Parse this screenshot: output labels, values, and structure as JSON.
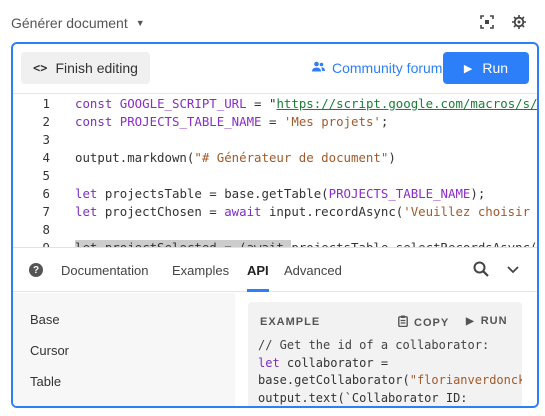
{
  "header": {
    "block_title": "Générer document",
    "icons": [
      "focus-icon",
      "settings-icon"
    ]
  },
  "toolbar": {
    "finish_label": "Finish editing",
    "forum_label": "Community forum",
    "run_label": "Run"
  },
  "editor": {
    "lines": [
      {
        "num": "1",
        "parts": [
          [
            "kw",
            "const "
          ],
          [
            "cn",
            "GOOGLE_SCRIPT_URL"
          ],
          [
            "id",
            " = \""
          ],
          [
            "url",
            "https://script.google.com/macros/s/AK"
          ]
        ]
      },
      {
        "num": "2",
        "parts": [
          [
            "kw",
            "const "
          ],
          [
            "cn",
            "PROJECTS_TABLE_NAME"
          ],
          [
            "id",
            " = "
          ],
          [
            "str",
            "'Mes projets'"
          ],
          [
            "id",
            ";"
          ]
        ]
      },
      {
        "num": "3",
        "parts": []
      },
      {
        "num": "4",
        "parts": [
          [
            "id",
            "output.markdown("
          ],
          [
            "str",
            "\"# Générateur de document\""
          ],
          [
            "id",
            ")"
          ]
        ]
      },
      {
        "num": "5",
        "parts": []
      },
      {
        "num": "6",
        "parts": [
          [
            "kw",
            "let "
          ],
          [
            "id",
            "projectsTable = base.getTable("
          ],
          [
            "cn",
            "PROJECTS_TABLE_NAME"
          ],
          [
            "id",
            ");"
          ]
        ]
      },
      {
        "num": "7",
        "parts": [
          [
            "kw",
            "let "
          ],
          [
            "id",
            "projectChosen = "
          ],
          [
            "kw",
            "await "
          ],
          [
            "id",
            "input.recordAsync("
          ],
          [
            "str",
            "'Veuillez choisir un"
          ]
        ]
      },
      {
        "num": "8",
        "parts": []
      },
      {
        "num": "9",
        "parts": [
          [
            "hl",
            "let projectSelected = (await "
          ],
          [
            "id",
            "projectsTable.selectRecordsAsync())"
          ]
        ]
      }
    ]
  },
  "docs": {
    "tabs": [
      "Documentation",
      "Examples",
      "API",
      "Advanced"
    ],
    "active_tab": "API",
    "sidebar": [
      "Base",
      "Cursor",
      "Table"
    ],
    "example": {
      "label": "EXAMPLE",
      "copy_label": "COPY",
      "run_label": "RUN",
      "code": [
        [
          [
            "cm",
            "// Get the id of a collaborator:"
          ]
        ],
        [
          [
            "kw",
            "let "
          ],
          [
            "id",
            "collaborator ="
          ]
        ],
        [
          [
            "id",
            "base.getCollaborator("
          ],
          [
            "str",
            "\"florianverdonck"
          ]
        ],
        [
          [
            "id",
            "output.text(`Collaborator ID:"
          ]
        ]
      ]
    }
  }
}
